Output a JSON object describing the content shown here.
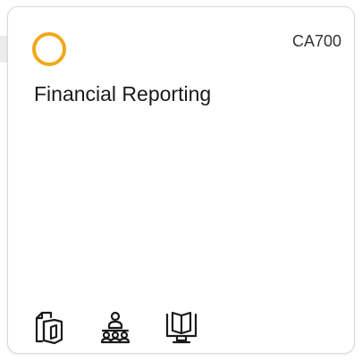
{
  "card": {
    "code": "CA700",
    "title": "Financial Reporting",
    "status_color": "#f0a81c"
  },
  "icons": [
    {
      "name": "documents-icon"
    },
    {
      "name": "group-learning-icon"
    },
    {
      "name": "online-book-icon"
    }
  ]
}
